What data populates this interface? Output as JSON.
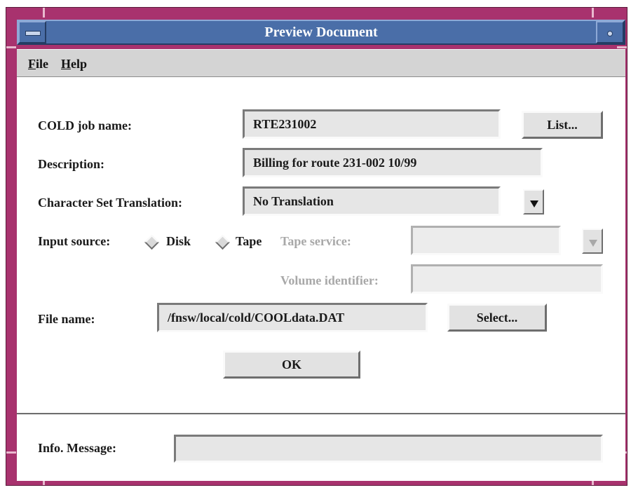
{
  "window": {
    "title": "Preview Document"
  },
  "menu": [
    {
      "mnemonic": "F",
      "rest": "ile"
    },
    {
      "mnemonic": "H",
      "rest": "elp"
    }
  ],
  "form": {
    "cold_job_name": {
      "label": "COLD job name:",
      "value": "RTE231002",
      "button": "List..."
    },
    "description": {
      "label": "Description:",
      "value": "Billing for route 231-002 10/99"
    },
    "charset": {
      "label": "Character Set Translation:",
      "value": "No Translation"
    },
    "input_source": {
      "label": "Input source:",
      "options": [
        "Disk",
        "Tape"
      ],
      "tape_service_label": "Tape service:",
      "tape_service_value": "",
      "volume_identifier_label": "Volume identifier:",
      "volume_identifier_value": ""
    },
    "file_name": {
      "label": "File name:",
      "value": "/fnsw/local/cold/COOLdata.DAT",
      "button": "Select..."
    },
    "ok_button": "OK"
  },
  "info": {
    "label": "Info. Message:",
    "value": ""
  },
  "colors": {
    "frame": "#a8326e",
    "titlebar": "#4a6ea8",
    "menubar": "#d4d4d4"
  }
}
